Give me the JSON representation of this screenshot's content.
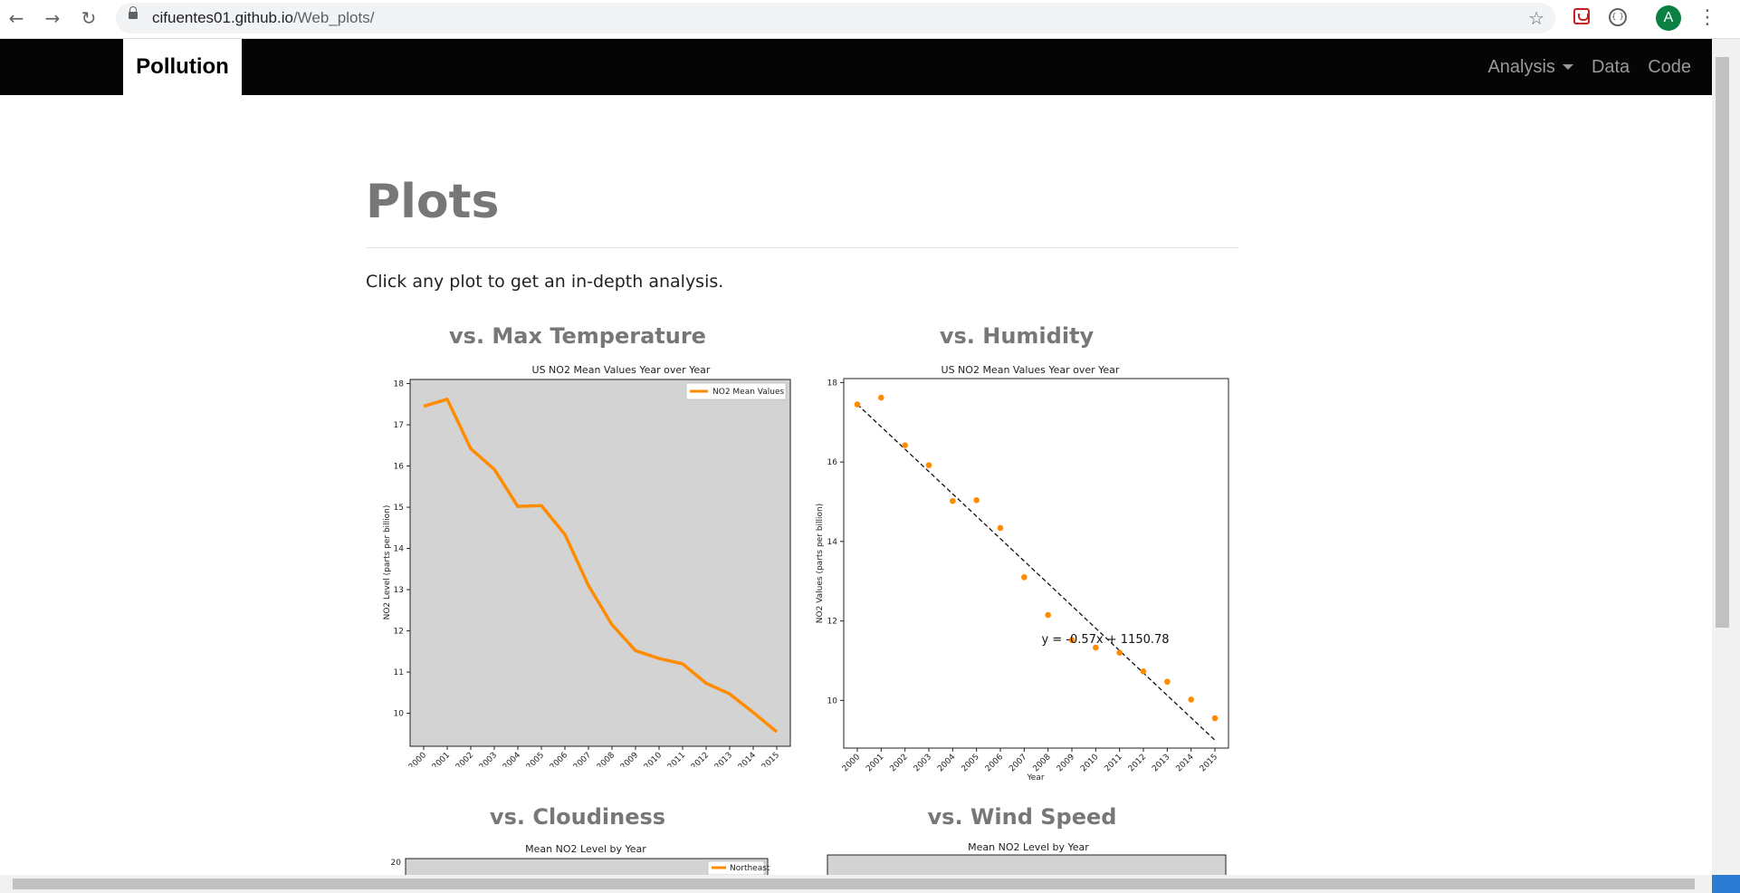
{
  "browser": {
    "back_icon": "arrow-left-icon",
    "forward_icon": "arrow-right-icon",
    "reload_icon": "reload-icon",
    "url_host": "cifuentes01.github.io",
    "url_path": "/Web_plots/",
    "avatar_letter": "A"
  },
  "navbar": {
    "brand": "Pollution",
    "items": [
      {
        "label": "Analysis"
      },
      {
        "label": "Data"
      },
      {
        "label": "Code"
      }
    ]
  },
  "page": {
    "title": "Plots",
    "intro": "Click any plot to get an in-depth analysis.",
    "sections": [
      {
        "heading": "vs. Max Temperature"
      },
      {
        "heading": "vs. Humidity"
      },
      {
        "heading": "vs. Cloudiness"
      },
      {
        "heading": "vs. Wind Speed"
      }
    ]
  },
  "chart_data": [
    {
      "type": "line",
      "title": "US NO2 Mean Values Year over Year",
      "xlabel": "",
      "ylabel": "NO2 Level (parts per billion)",
      "x": [
        "2000",
        "2001",
        "2002",
        "2003",
        "2004",
        "2005",
        "2006",
        "2007",
        "2008",
        "2009",
        "2010",
        "2011",
        "2012",
        "2013",
        "2014",
        "2015"
      ],
      "series": [
        {
          "name": "NO2 Mean Values",
          "values": [
            17.45,
            17.62,
            16.42,
            15.92,
            15.02,
            15.04,
            14.34,
            13.1,
            12.15,
            11.52,
            11.33,
            11.2,
            10.73,
            10.47,
            10.02,
            9.55
          ],
          "color": "#ff8c00"
        }
      ],
      "ylim": [
        9.2,
        18.1
      ],
      "yticks": [
        10,
        11,
        12,
        13,
        14,
        15,
        16,
        17,
        18
      ],
      "legend": "top-right",
      "background": "#d3d3d3"
    },
    {
      "type": "scatter",
      "title": "US NO2 Mean Values Year over Year",
      "xlabel": "Year",
      "ylabel": "NO2 Values (parts per billion)",
      "x": [
        "2000",
        "2001",
        "2002",
        "2003",
        "2004",
        "2005",
        "2006",
        "2007",
        "2008",
        "2009",
        "2010",
        "2011",
        "2012",
        "2013",
        "2014",
        "2015"
      ],
      "series": [
        {
          "values": [
            17.45,
            17.62,
            16.42,
            15.92,
            15.02,
            15.04,
            14.34,
            13.1,
            12.15,
            11.52,
            11.33,
            11.2,
            10.73,
            10.47,
            10.02,
            9.55
          ],
          "color": "#ff8c00"
        }
      ],
      "fit": {
        "equation": "y = -0.57x + 1150.78",
        "slope": -0.57,
        "start": 17.45,
        "end": 9.0
      },
      "ylim": [
        8.8,
        18.1
      ],
      "yticks": [
        10,
        12,
        14,
        16,
        18
      ],
      "background": "#ffffff"
    },
    {
      "type": "line",
      "title": "Mean NO2 Level by Year",
      "yticks": [
        20
      ],
      "series": [
        {
          "name": "Northeast",
          "color": "#ff8c00"
        }
      ],
      "legend": "top-right",
      "background": "#d3d3d3"
    },
    {
      "type": "other",
      "title": "Mean NO2 Level by Year",
      "background": "#d3d3d3"
    }
  ]
}
